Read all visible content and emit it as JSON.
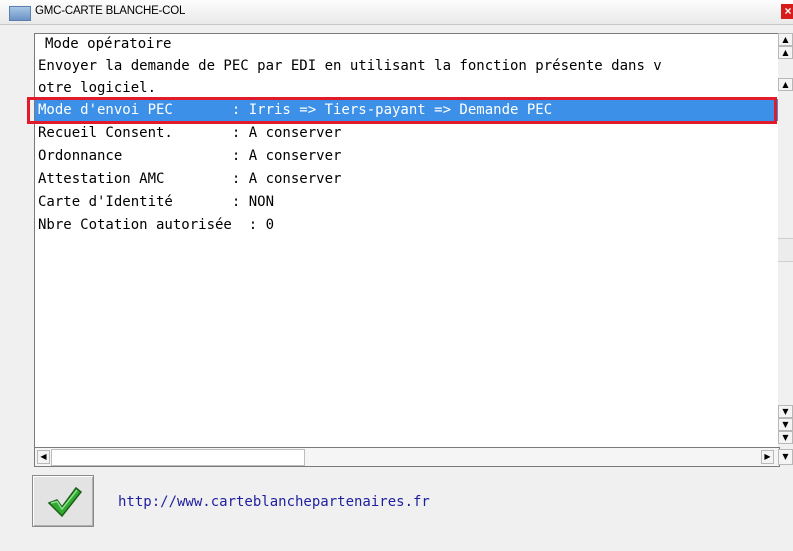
{
  "window": {
    "title": "GMC-CARTE BLANCHE-COL",
    "close_glyph": "×"
  },
  "panel": {
    "header": "Mode opératoire",
    "lines": [
      "Envoyer la demande de PEC par EDI en utilisant la fonction présente dans v",
      "otre logiciel.",
      "Mode d'envoi PEC       : Irris => Tiers-payant => Demande PEC",
      "Recueil Consent.       : A conserver",
      "Ordonnance             : A conserver",
      "Attestation AMC        : A conserver",
      "Carte d'Identité       : NON",
      "Nbre Cotation autorisée  : 0"
    ],
    "selected_line": "Mode d'envoi PEC       : Irris => Tiers-payant => Demande PEC"
  },
  "footer": {
    "link": "http://www.carteblanchepartenaires.fr"
  },
  "icons": {
    "window_icon": "app-window-icon",
    "ok": "green-checkmark-icon",
    "scroll_up": "arrow-up-icon",
    "scroll_down": "arrow-down-icon",
    "scroll_left": "arrow-left-icon",
    "scroll_right": "arrow-right-icon"
  },
  "colors": {
    "selection": "#3d90e8",
    "highlight_border": "#e21b2b",
    "link": "#1f1f9f"
  }
}
